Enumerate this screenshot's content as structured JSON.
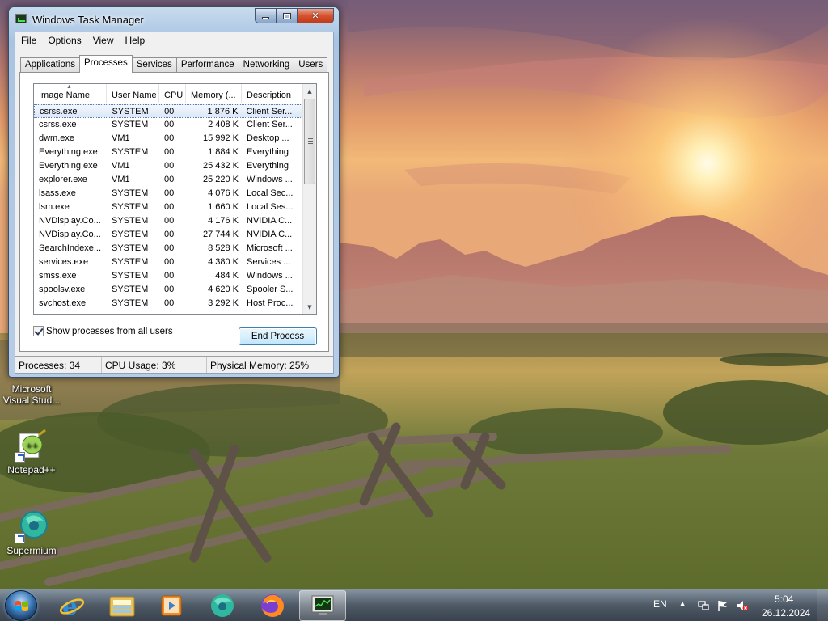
{
  "window": {
    "title": "Windows Task Manager",
    "menu": [
      "File",
      "Options",
      "View",
      "Help"
    ],
    "tabs": [
      "Applications",
      "Processes",
      "Services",
      "Performance",
      "Networking",
      "Users"
    ],
    "active_tab": "Processes"
  },
  "process_list": {
    "columns": [
      "Image Name",
      "User Name",
      "CPU",
      "Memory (...",
      "Description"
    ],
    "rows": [
      {
        "image": "csrss.exe",
        "user": "SYSTEM",
        "cpu": "00",
        "memory": "1 876 K",
        "description": "Client Ser..."
      },
      {
        "image": "csrss.exe",
        "user": "SYSTEM",
        "cpu": "00",
        "memory": "2 408 K",
        "description": "Client Ser..."
      },
      {
        "image": "dwm.exe",
        "user": "VM1",
        "cpu": "00",
        "memory": "15 992 K",
        "description": "Desktop ..."
      },
      {
        "image": "Everything.exe",
        "user": "SYSTEM",
        "cpu": "00",
        "memory": "1 884 K",
        "description": "Everything"
      },
      {
        "image": "Everything.exe",
        "user": "VM1",
        "cpu": "00",
        "memory": "25 432 K",
        "description": "Everything"
      },
      {
        "image": "explorer.exe",
        "user": "VM1",
        "cpu": "00",
        "memory": "25 220 K",
        "description": "Windows ..."
      },
      {
        "image": "lsass.exe",
        "user": "SYSTEM",
        "cpu": "00",
        "memory": "4 076 K",
        "description": "Local Sec..."
      },
      {
        "image": "lsm.exe",
        "user": "SYSTEM",
        "cpu": "00",
        "memory": "1 660 K",
        "description": "Local Ses..."
      },
      {
        "image": "NVDisplay.Co...",
        "user": "SYSTEM",
        "cpu": "00",
        "memory": "4 176 K",
        "description": "NVIDIA C..."
      },
      {
        "image": "NVDisplay.Co...",
        "user": "SYSTEM",
        "cpu": "00",
        "memory": "27 744 K",
        "description": "NVIDIA C..."
      },
      {
        "image": "SearchIndexe...",
        "user": "SYSTEM",
        "cpu": "00",
        "memory": "8 528 K",
        "description": "Microsoft ..."
      },
      {
        "image": "services.exe",
        "user": "SYSTEM",
        "cpu": "00",
        "memory": "4 380 K",
        "description": "Services ..."
      },
      {
        "image": "smss.exe",
        "user": "SYSTEM",
        "cpu": "00",
        "memory": "484 K",
        "description": "Windows ..."
      },
      {
        "image": "spoolsv.exe",
        "user": "SYSTEM",
        "cpu": "00",
        "memory": "4 620 K",
        "description": "Spooler S..."
      },
      {
        "image": "svchost.exe",
        "user": "SYSTEM",
        "cpu": "00",
        "memory": "3 292 K",
        "description": "Host Proc..."
      }
    ],
    "selected_index": 0
  },
  "controls": {
    "show_all_label": "Show processes from all users",
    "show_all_checked": true,
    "end_process_label": "End Process"
  },
  "statusbar": {
    "processes": "Processes: 34",
    "cpu": "CPU Usage: 3%",
    "memory": "Physical Memory: 25%"
  },
  "desktop_icons": [
    {
      "label": "Microsoft Visual Stud...",
      "icon": "visual-studio-icon"
    },
    {
      "label": "Notepad++",
      "icon": "notepad-plus-plus-icon"
    },
    {
      "label": "Supermium",
      "icon": "supermium-icon"
    }
  ],
  "taskbar": {
    "pinned": [
      "internet-explorer-icon",
      "file-explorer-icon",
      "media-player-icon",
      "supermium-icon",
      "firefox-icon",
      "task-manager-icon"
    ],
    "language": "EN",
    "time": "5:04",
    "date": "26.12.2024"
  }
}
